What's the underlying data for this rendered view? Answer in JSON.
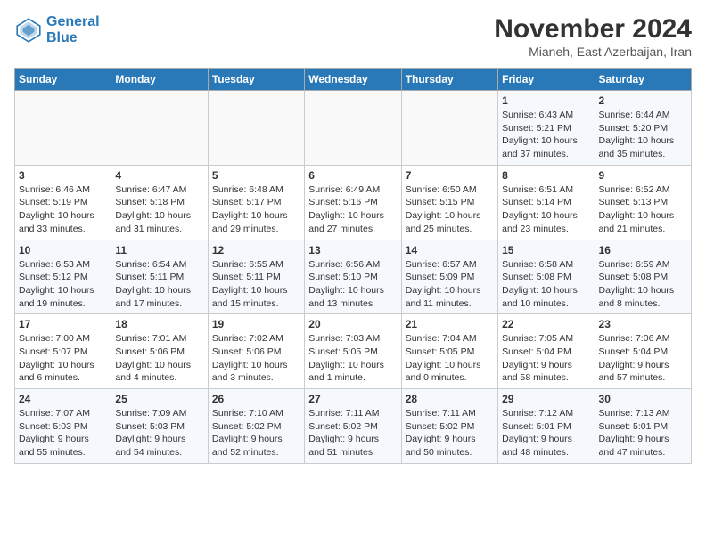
{
  "logo": {
    "line1": "General",
    "line2": "Blue"
  },
  "title": "November 2024",
  "location": "Mianeh, East Azerbaijan, Iran",
  "weekdays": [
    "Sunday",
    "Monday",
    "Tuesday",
    "Wednesday",
    "Thursday",
    "Friday",
    "Saturday"
  ],
  "weeks": [
    [
      {
        "day": "",
        "info": ""
      },
      {
        "day": "",
        "info": ""
      },
      {
        "day": "",
        "info": ""
      },
      {
        "day": "",
        "info": ""
      },
      {
        "day": "",
        "info": ""
      },
      {
        "day": "1",
        "info": "Sunrise: 6:43 AM\nSunset: 5:21 PM\nDaylight: 10 hours\nand 37 minutes."
      },
      {
        "day": "2",
        "info": "Sunrise: 6:44 AM\nSunset: 5:20 PM\nDaylight: 10 hours\nand 35 minutes."
      }
    ],
    [
      {
        "day": "3",
        "info": "Sunrise: 6:46 AM\nSunset: 5:19 PM\nDaylight: 10 hours\nand 33 minutes."
      },
      {
        "day": "4",
        "info": "Sunrise: 6:47 AM\nSunset: 5:18 PM\nDaylight: 10 hours\nand 31 minutes."
      },
      {
        "day": "5",
        "info": "Sunrise: 6:48 AM\nSunset: 5:17 PM\nDaylight: 10 hours\nand 29 minutes."
      },
      {
        "day": "6",
        "info": "Sunrise: 6:49 AM\nSunset: 5:16 PM\nDaylight: 10 hours\nand 27 minutes."
      },
      {
        "day": "7",
        "info": "Sunrise: 6:50 AM\nSunset: 5:15 PM\nDaylight: 10 hours\nand 25 minutes."
      },
      {
        "day": "8",
        "info": "Sunrise: 6:51 AM\nSunset: 5:14 PM\nDaylight: 10 hours\nand 23 minutes."
      },
      {
        "day": "9",
        "info": "Sunrise: 6:52 AM\nSunset: 5:13 PM\nDaylight: 10 hours\nand 21 minutes."
      }
    ],
    [
      {
        "day": "10",
        "info": "Sunrise: 6:53 AM\nSunset: 5:12 PM\nDaylight: 10 hours\nand 19 minutes."
      },
      {
        "day": "11",
        "info": "Sunrise: 6:54 AM\nSunset: 5:11 PM\nDaylight: 10 hours\nand 17 minutes."
      },
      {
        "day": "12",
        "info": "Sunrise: 6:55 AM\nSunset: 5:11 PM\nDaylight: 10 hours\nand 15 minutes."
      },
      {
        "day": "13",
        "info": "Sunrise: 6:56 AM\nSunset: 5:10 PM\nDaylight: 10 hours\nand 13 minutes."
      },
      {
        "day": "14",
        "info": "Sunrise: 6:57 AM\nSunset: 5:09 PM\nDaylight: 10 hours\nand 11 minutes."
      },
      {
        "day": "15",
        "info": "Sunrise: 6:58 AM\nSunset: 5:08 PM\nDaylight: 10 hours\nand 10 minutes."
      },
      {
        "day": "16",
        "info": "Sunrise: 6:59 AM\nSunset: 5:08 PM\nDaylight: 10 hours\nand 8 minutes."
      }
    ],
    [
      {
        "day": "17",
        "info": "Sunrise: 7:00 AM\nSunset: 5:07 PM\nDaylight: 10 hours\nand 6 minutes."
      },
      {
        "day": "18",
        "info": "Sunrise: 7:01 AM\nSunset: 5:06 PM\nDaylight: 10 hours\nand 4 minutes."
      },
      {
        "day": "19",
        "info": "Sunrise: 7:02 AM\nSunset: 5:06 PM\nDaylight: 10 hours\nand 3 minutes."
      },
      {
        "day": "20",
        "info": "Sunrise: 7:03 AM\nSunset: 5:05 PM\nDaylight: 10 hours\nand 1 minute."
      },
      {
        "day": "21",
        "info": "Sunrise: 7:04 AM\nSunset: 5:05 PM\nDaylight: 10 hours\nand 0 minutes."
      },
      {
        "day": "22",
        "info": "Sunrise: 7:05 AM\nSunset: 5:04 PM\nDaylight: 9 hours\nand 58 minutes."
      },
      {
        "day": "23",
        "info": "Sunrise: 7:06 AM\nSunset: 5:04 PM\nDaylight: 9 hours\nand 57 minutes."
      }
    ],
    [
      {
        "day": "24",
        "info": "Sunrise: 7:07 AM\nSunset: 5:03 PM\nDaylight: 9 hours\nand 55 minutes."
      },
      {
        "day": "25",
        "info": "Sunrise: 7:09 AM\nSunset: 5:03 PM\nDaylight: 9 hours\nand 54 minutes."
      },
      {
        "day": "26",
        "info": "Sunrise: 7:10 AM\nSunset: 5:02 PM\nDaylight: 9 hours\nand 52 minutes."
      },
      {
        "day": "27",
        "info": "Sunrise: 7:11 AM\nSunset: 5:02 PM\nDaylight: 9 hours\nand 51 minutes."
      },
      {
        "day": "28",
        "info": "Sunrise: 7:11 AM\nSunset: 5:02 PM\nDaylight: 9 hours\nand 50 minutes."
      },
      {
        "day": "29",
        "info": "Sunrise: 7:12 AM\nSunset: 5:01 PM\nDaylight: 9 hours\nand 48 minutes."
      },
      {
        "day": "30",
        "info": "Sunrise: 7:13 AM\nSunset: 5:01 PM\nDaylight: 9 hours\nand 47 minutes."
      }
    ]
  ]
}
